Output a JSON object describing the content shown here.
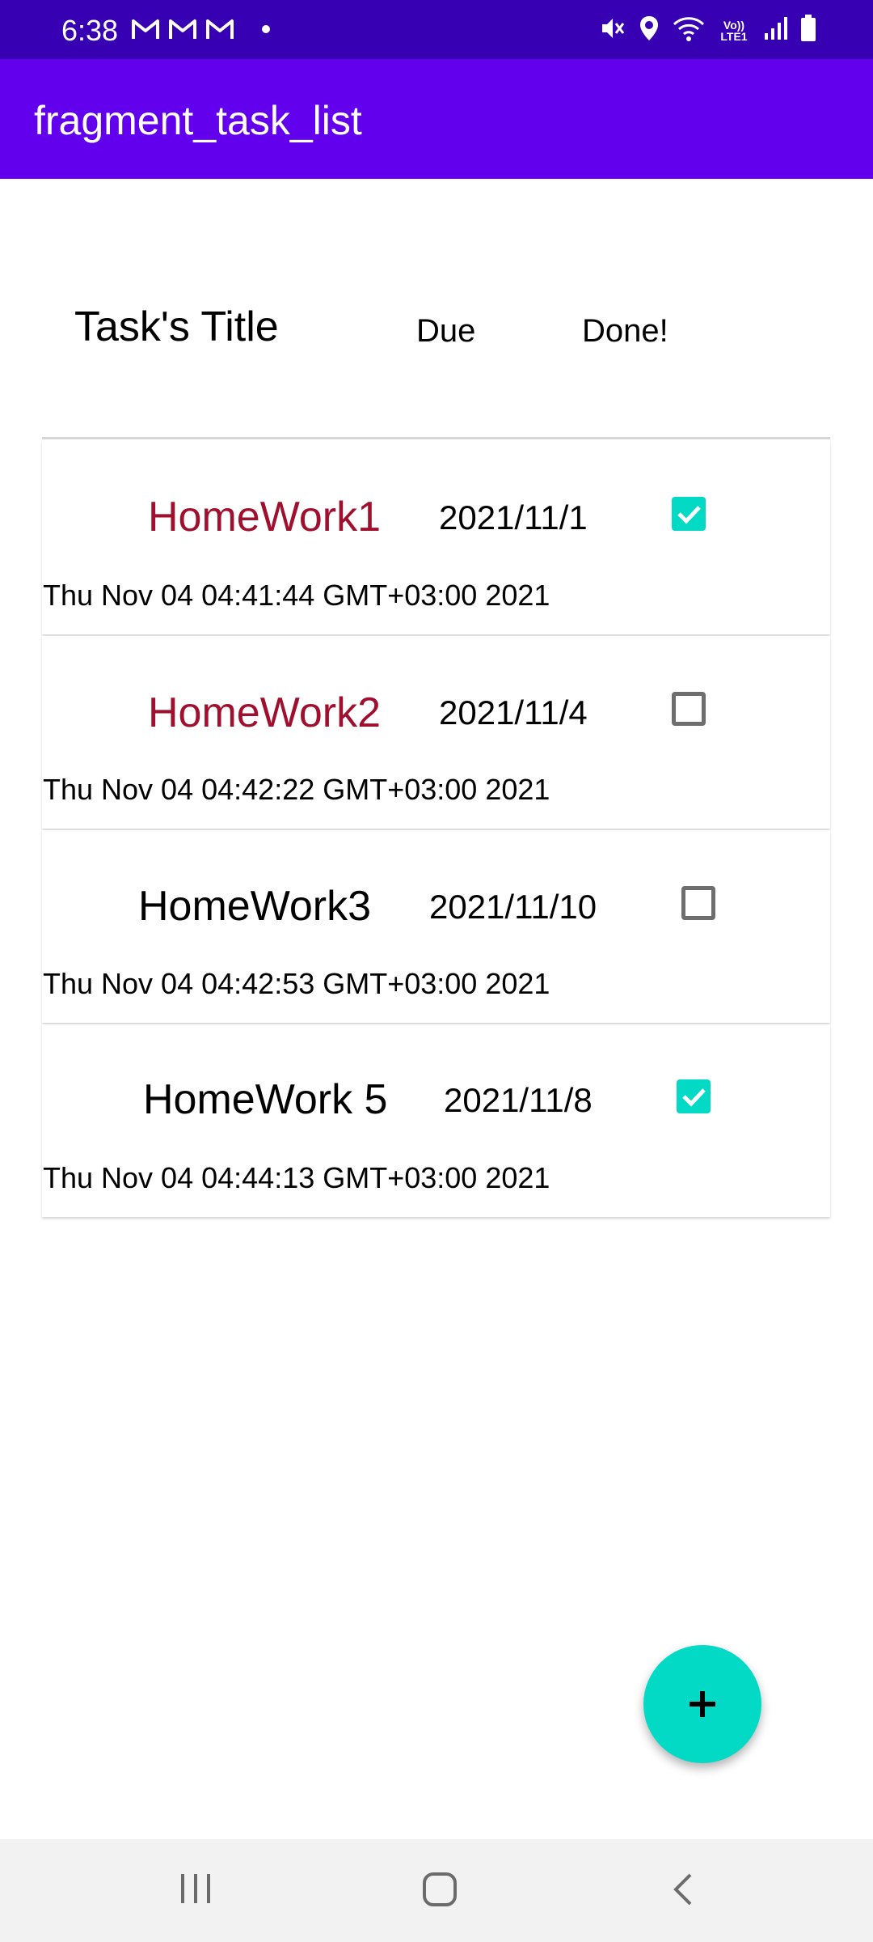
{
  "status_bar": {
    "time": "6:38",
    "left_icons": [
      "gmail-icon",
      "gmail-icon",
      "gmail-icon",
      "notification-dot-icon"
    ],
    "right_icons": [
      "mute-icon",
      "location-icon",
      "wifi-icon",
      "volte-lte-icon",
      "signal-icon",
      "battery-icon"
    ],
    "volte_label": "Vo)) LTE1"
  },
  "app_bar": {
    "title": "fragment_task_list"
  },
  "header": {
    "title": "Task's Title",
    "due": "Due",
    "done": "Done!"
  },
  "tasks": [
    {
      "title": "HomeWork1",
      "due": "2021/11/1",
      "done": true,
      "created": "Thu Nov 04 04:41:44 GMT+03:00 2021",
      "title_color": "#a0102e"
    },
    {
      "title": "HomeWork2",
      "due": "2021/11/4",
      "done": false,
      "created": "Thu Nov 04 04:42:22 GMT+03:00 2021",
      "title_color": "#a0102e"
    },
    {
      "title": "HomeWork3",
      "due": "2021/11/10",
      "done": false,
      "created": "Thu Nov 04 04:42:53 GMT+03:00 2021",
      "title_color": "#000000"
    },
    {
      "title": "HomeWork 5",
      "due": "2021/11/8",
      "done": true,
      "created": "Thu Nov 04 04:44:13 GMT+03:00 2021",
      "title_color": "#000000"
    }
  ],
  "fab": {
    "icon": "plus-icon"
  },
  "nav_bar": {
    "icons": [
      "recent-apps-icon",
      "home-icon",
      "back-icon"
    ]
  },
  "colors": {
    "status_bar": "#3700b3",
    "app_bar": "#6200ee",
    "accent": "#03dac5",
    "overdue_title": "#a0102e"
  }
}
